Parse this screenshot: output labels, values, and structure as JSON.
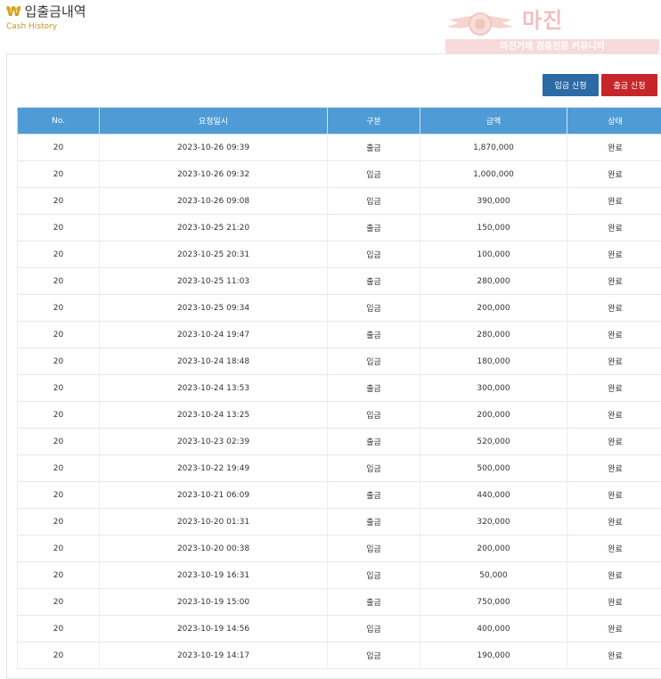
{
  "header": {
    "icon": "won-sign-icon",
    "icon_glyph": "₩",
    "title": "입출금내역",
    "subtitle": "Cash History"
  },
  "watermark": {
    "logo": "마진",
    "tagline": "마진거래 검증전문 커뮤니티"
  },
  "buttons": {
    "deposit_label": "입금 신청",
    "withdraw_label": "출금 신청"
  },
  "colors": {
    "header_bg": "#4f9bd6",
    "deposit_button": "#2c6aa6",
    "withdraw_button": "#c6262a",
    "withdraw_text": "#b32020",
    "deposit_text": "#2e8b7a",
    "title_accent": "#c8962a"
  },
  "table": {
    "columns": [
      "No.",
      "요청일시",
      "구분",
      "금액",
      "상태"
    ],
    "rows": [
      {
        "no": "20",
        "datetime": "2023-10-26 09:39",
        "kind": "출금",
        "amount": "1,870,000",
        "status": "완료"
      },
      {
        "no": "20",
        "datetime": "2023-10-26 09:32",
        "kind": "입금",
        "amount": "1,000,000",
        "status": "완료"
      },
      {
        "no": "20",
        "datetime": "2023-10-26 09:08",
        "kind": "입금",
        "amount": "390,000",
        "status": "완료"
      },
      {
        "no": "20",
        "datetime": "2023-10-25 21:20",
        "kind": "출금",
        "amount": "150,000",
        "status": "완료"
      },
      {
        "no": "20",
        "datetime": "2023-10-25 20:31",
        "kind": "입금",
        "amount": "100,000",
        "status": "완료"
      },
      {
        "no": "20",
        "datetime": "2023-10-25 11:03",
        "kind": "출금",
        "amount": "280,000",
        "status": "완료"
      },
      {
        "no": "20",
        "datetime": "2023-10-25 09:34",
        "kind": "입금",
        "amount": "200,000",
        "status": "완료"
      },
      {
        "no": "20",
        "datetime": "2023-10-24 19:47",
        "kind": "출금",
        "amount": "280,000",
        "status": "완료"
      },
      {
        "no": "20",
        "datetime": "2023-10-24 18:48",
        "kind": "입금",
        "amount": "180,000",
        "status": "완료"
      },
      {
        "no": "20",
        "datetime": "2023-10-24 13:53",
        "kind": "출금",
        "amount": "300,000",
        "status": "완료"
      },
      {
        "no": "20",
        "datetime": "2023-10-24 13:25",
        "kind": "입금",
        "amount": "200,000",
        "status": "완료"
      },
      {
        "no": "20",
        "datetime": "2023-10-23 02:39",
        "kind": "출금",
        "amount": "520,000",
        "status": "완료"
      },
      {
        "no": "20",
        "datetime": "2023-10-22 19:49",
        "kind": "입금",
        "amount": "500,000",
        "status": "완료"
      },
      {
        "no": "20",
        "datetime": "2023-10-21 06:09",
        "kind": "출금",
        "amount": "440,000",
        "status": "완료"
      },
      {
        "no": "20",
        "datetime": "2023-10-20 01:31",
        "kind": "출금",
        "amount": "320,000",
        "status": "완료"
      },
      {
        "no": "20",
        "datetime": "2023-10-20 00:38",
        "kind": "입금",
        "amount": "200,000",
        "status": "완료"
      },
      {
        "no": "20",
        "datetime": "2023-10-19 16:31",
        "kind": "입금",
        "amount": "50,000",
        "status": "완료"
      },
      {
        "no": "20",
        "datetime": "2023-10-19 15:00",
        "kind": "출금",
        "amount": "750,000",
        "status": "완료"
      },
      {
        "no": "20",
        "datetime": "2023-10-19 14:56",
        "kind": "입금",
        "amount": "400,000",
        "status": "완료"
      },
      {
        "no": "20",
        "datetime": "2023-10-19 14:17",
        "kind": "입금",
        "amount": "190,000",
        "status": "완료"
      }
    ]
  }
}
